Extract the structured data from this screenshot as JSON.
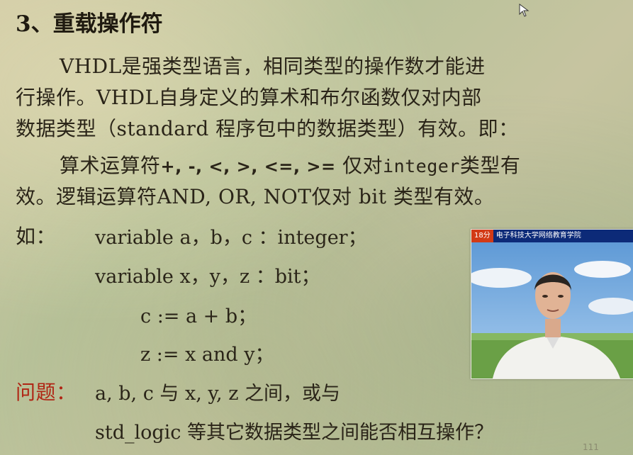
{
  "slide": {
    "title": "3、重载操作符",
    "para1": {
      "line1": "VHDL是强类型语言，相同类型的操作数才能进",
      "line2": "行操作。VHDL自身定义的算术和布尔函数仅对内部",
      "line3": "数据类型（standard 程序包中的数据类型）有效。即："
    },
    "para2": {
      "line1_prefix": "算术运算符",
      "line1_ops": "+, -, <, >, <=, >=",
      "line1_mid": " 仅对",
      "line1_mono": "integer",
      "line1_suffix": "类型有",
      "line2": "效。逻辑运算符AND, OR, NOT仅对 bit 类型有效。"
    },
    "example": {
      "label": "如：",
      "code1": "variable  a，b，c ：integer；",
      "code2": "variable  x，y，z ：bit；",
      "code3": "c := a + b；",
      "code4": "z := x and y；"
    },
    "question": {
      "label": "问题：",
      "line1": "a, b, c 与 x, y, z 之间，或与",
      "line2": "std_logic 等其它数据类型之间能否相互操作？"
    },
    "page_number": "111"
  },
  "video": {
    "time_badge": "18分",
    "channel": "电子科技大学网络教育学院"
  },
  "colors": {
    "question_label": "#b02514",
    "video_bar": "#0c2a78",
    "badge": "#d23a16"
  },
  "icons": {
    "cursor": "mouse-pointer-icon"
  }
}
